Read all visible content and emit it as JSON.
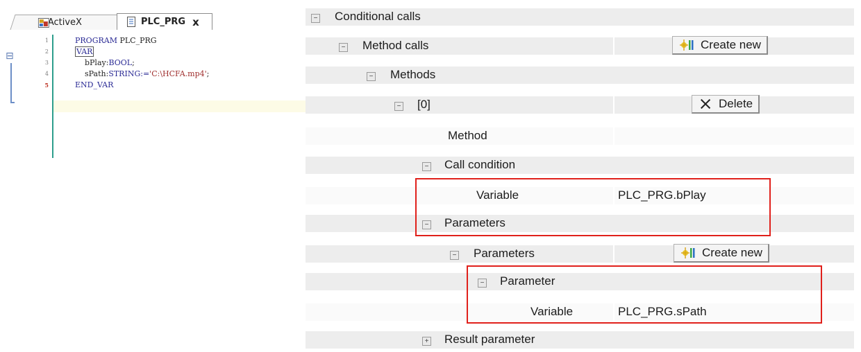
{
  "editor": {
    "tabs": [
      {
        "label": "ActiveX",
        "icon": "activex-icon"
      },
      {
        "label": "PLC_PRG",
        "icon": "pou-icon",
        "close": "x"
      }
    ],
    "line_numbers": [
      "1",
      "2",
      "3",
      "4",
      "5"
    ],
    "code": {
      "l1_kw": "PROGRAM",
      "l1_name": " PLC_PRG",
      "l2_kw": "VAR",
      "l3_name": "    bPlay:",
      "l3_type": "BOOL",
      "l3_end": ";",
      "l4_name": "    sPath:",
      "l4_type": "STRING",
      "l4_op": ":=",
      "l4_str": "'C:\\HCFA.mp4'",
      "l4_end": ";",
      "l5_kw": "END_VAR"
    }
  },
  "grid": {
    "conditional_calls": "Conditional calls",
    "method_calls": "Method calls",
    "create_new_1": "Create new",
    "methods": "Methods",
    "index0": "[0]",
    "delete": "Delete",
    "method": "Method",
    "call_condition": "Call condition",
    "variable_1_label": "Variable",
    "variable_1_value": "PLC_PRG.bPlay",
    "parameters_group": "Parameters",
    "parameters_list": "Parameters",
    "create_new_2": "Create new",
    "parameter": "Parameter",
    "variable_2_label": "Variable",
    "variable_2_value": "PLC_PRG.sPath",
    "result_parameter": "Result parameter",
    "collapse_glyph": "−",
    "expand_glyph": "+"
  },
  "colors": {
    "highlight_box": "#e0201b",
    "group_row": "#ededed",
    "editor_margin_line": "#2d9e8c",
    "keyword": "#2b2b95",
    "string": "#a0302f"
  }
}
